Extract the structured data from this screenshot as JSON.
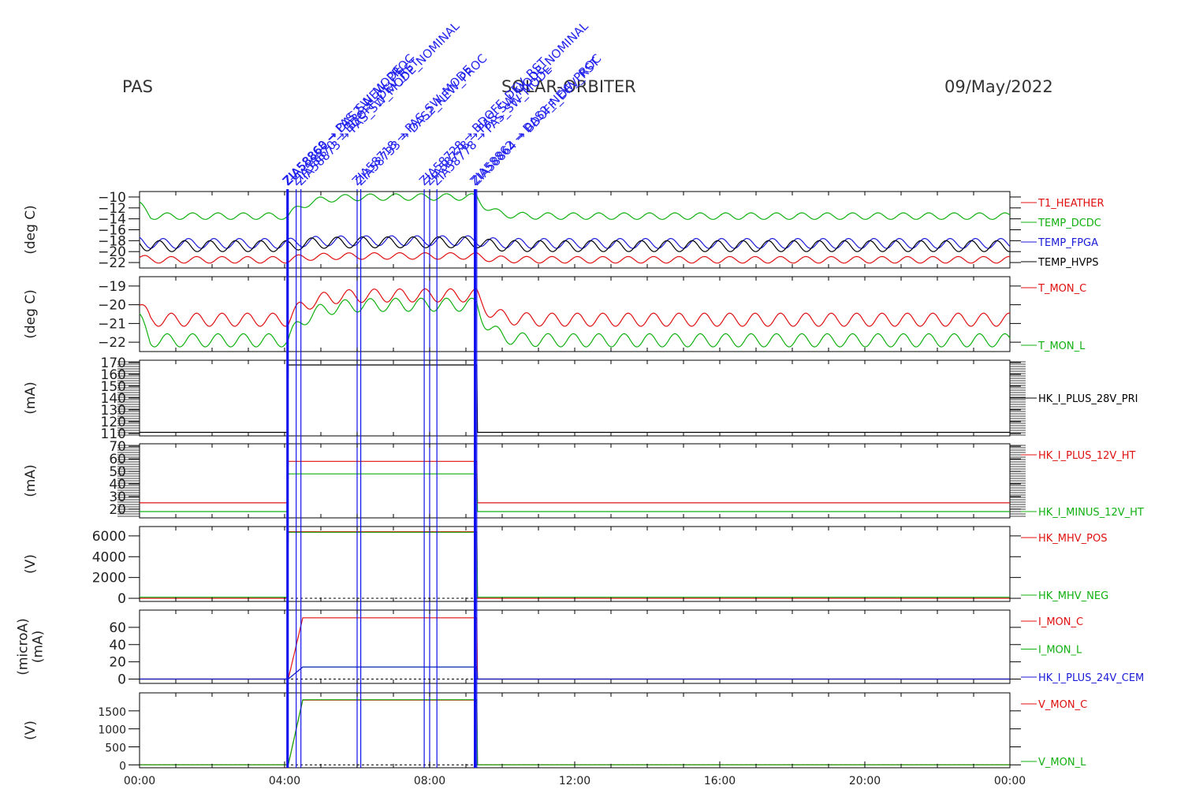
{
  "header": {
    "instrument": "PAS",
    "mission": "SOLAR-ORBITER",
    "date": "09/May/2022"
  },
  "x_axis": {
    "ticks": [
      "00:00",
      "04:00",
      "08:00",
      "12:00",
      "16:00",
      "20:00",
      "00:00"
    ]
  },
  "colors": {
    "red": "#e01010",
    "green": "#10b010",
    "blue": "#1a1ad8",
    "black": "#000000",
    "brown": "#8b5a1a",
    "event": "#1010ee"
  },
  "events": [
    {
      "t": 4.08,
      "label": "ZIA58868"
    },
    {
      "t": 4.1,
      "label": "ZIA58860"
    },
    {
      "t": 4.32,
      "label": "ZIA58870"
    },
    {
      "t": 4.45,
      "label": "ZIA58873"
    },
    {
      "t": 6.0,
      "label": "ZIA58718"
    },
    {
      "t": 6.1,
      "label": "ZIA58733"
    },
    {
      "t": 7.85,
      "label": "ZIA58728"
    },
    {
      "t": 8.0,
      "label": "ZIA58778"
    },
    {
      "t": 8.2,
      "label": "ZIA58778"
    },
    {
      "t": 9.25,
      "label": "ZIA58862"
    },
    {
      "t": 9.3,
      "label": "ZIA58864"
    }
  ],
  "event_texts": [
    "PAS_SW_MODE",
    "DAS2_NEW_PROC",
    "BDOFF_DEV_RST",
    "PAS_SW_MODE_NOMINAL"
  ],
  "chart_data": [
    {
      "type": "line",
      "unit": "(deg C)",
      "ylim": [
        -23,
        -9
      ],
      "yticks": [
        -22,
        -20,
        -18,
        -16,
        -14,
        -12,
        -10
      ],
      "series": [
        {
          "name": "T1_HEATHER",
          "color": "red",
          "base": -21.5,
          "on": -20.8,
          "amp": 0.6,
          "period": 0.7
        },
        {
          "name": "TEMP_DCDC",
          "color": "green",
          "base": -13.5,
          "on": -10.0,
          "amp": 0.6,
          "period": 0.7
        },
        {
          "name": "TEMP_FPGA",
          "color": "blue",
          "base": -18.5,
          "on": -18.0,
          "amp": 0.9,
          "period": 0.7
        },
        {
          "name": "TEMP_HVPS",
          "color": "black",
          "base": -19.0,
          "on": -18.3,
          "amp": 1.0,
          "period": 0.7
        }
      ]
    },
    {
      "type": "line",
      "unit": "(deg C)",
      "ylim": [
        -22.5,
        -18.5
      ],
      "yticks": [
        -22,
        -21,
        -20,
        -19
      ],
      "series": [
        {
          "name": "T_MON_C",
          "color": "red",
          "base": -20.8,
          "on": -19.5,
          "amp": 0.35,
          "period": 0.7
        },
        {
          "name": "T_MON_L",
          "color": "green",
          "base": -21.9,
          "on": -20.0,
          "amp": 0.35,
          "period": 0.7
        }
      ]
    },
    {
      "type": "line",
      "unit": "(mA)",
      "ylim": [
        108,
        172
      ],
      "yticks": [
        110,
        120,
        130,
        140,
        150,
        160,
        170
      ],
      "series": [
        {
          "name": "HK_I_PLUS_28V_PRI",
          "color": "black",
          "base": 111,
          "on": 168
        }
      ]
    },
    {
      "type": "line",
      "unit": "(mA)",
      "ylim": [
        13,
        72
      ],
      "yticks": [
        20,
        30,
        40,
        50,
        60,
        70
      ],
      "series": [
        {
          "name": "HK_I_PLUS_12V_HT",
          "color": "red",
          "base": 25,
          "on": 58
        },
        {
          "name": "HK_I_MINUS_12V_HT",
          "color": "green",
          "base": 18,
          "on": 48
        }
      ]
    },
    {
      "type": "line",
      "unit": "(V)",
      "ylim": [
        -300,
        6900
      ],
      "yticks": [
        0,
        2000,
        4000,
        6000
      ],
      "series": [
        {
          "name": "HK_MHV_POS",
          "color": "red",
          "base": 0,
          "on": 6400
        },
        {
          "name": "HK_MHV_NEG",
          "color": "green",
          "base": 100,
          "on": 6350
        }
      ]
    },
    {
      "type": "line",
      "unit": "(microA)\n(mA)",
      "ylim": [
        -5,
        80
      ],
      "yticks": [
        0,
        20,
        40,
        60
      ],
      "series": [
        {
          "name": "I_MON_C",
          "color": "red",
          "base": 0,
          "on": 71
        },
        {
          "name": "I_MON_L",
          "color": "green",
          "base": 0,
          "on": 14
        },
        {
          "name": "HK_I_PLUS_24V_CEM",
          "color": "blue",
          "base": 0,
          "on": 14
        }
      ]
    },
    {
      "type": "line",
      "unit": "(V)",
      "ylim": [
        -80,
        2000
      ],
      "yticks": [
        0,
        500,
        1000,
        1500
      ],
      "series": [
        {
          "name": "V_MON_C",
          "color": "red",
          "base": 0,
          "on": 1800
        },
        {
          "name": "V_MON_L",
          "color": "green",
          "base": 0,
          "on": 1810
        }
      ]
    }
  ]
}
